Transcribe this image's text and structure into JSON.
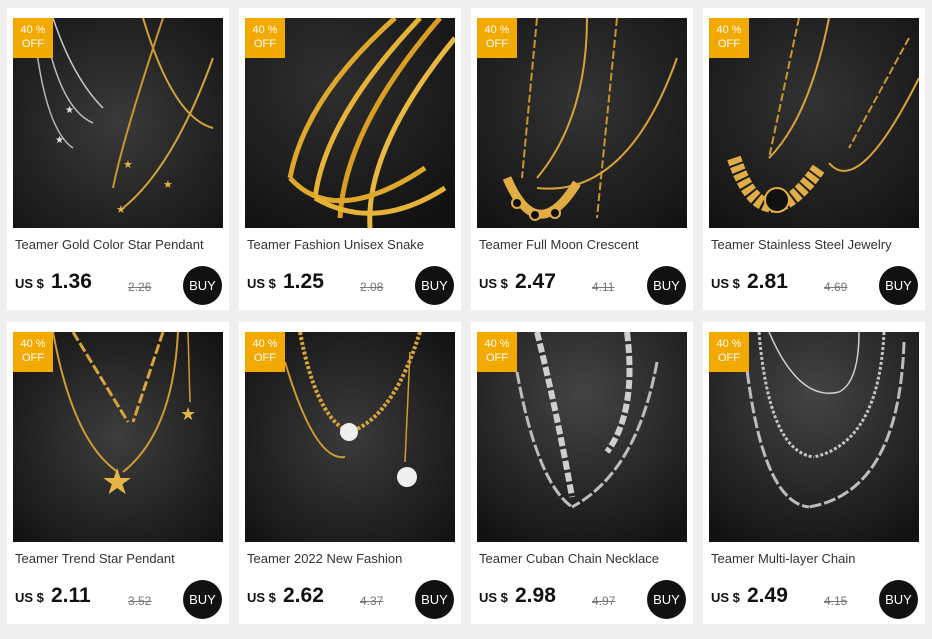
{
  "colors": {
    "badge": "#f2a900",
    "buy_button": "#111111",
    "page_bg": "#efefef"
  },
  "products": [
    {
      "badge_pct": "40 %",
      "badge_off": "OFF",
      "title": "Teamer Gold Color Star Pendant",
      "currency": "US $",
      "price": "1.36",
      "old_price": "2.26",
      "buy_label": "BUY",
      "image": "necklace-gold-silver-stars"
    },
    {
      "badge_pct": "40 %",
      "badge_off": "OFF",
      "title": "Teamer Fashion Unisex Snake",
      "currency": "US $",
      "price": "1.25",
      "old_price": "2.08",
      "buy_label": "BUY",
      "image": "necklace-gold-snake-chains"
    },
    {
      "badge_pct": "40 %",
      "badge_off": "OFF",
      "title": "Teamer Full Moon Crescent",
      "currency": "US $",
      "price": "2.47",
      "old_price": "4.11",
      "buy_label": "BUY",
      "image": "necklace-gold-moon-crescent"
    },
    {
      "badge_pct": "40 %",
      "badge_off": "OFF",
      "title": "Teamer Stainless Steel Jewelry",
      "currency": "US $",
      "price": "2.81",
      "old_price": "4.69",
      "buy_label": "BUY",
      "image": "necklace-gold-lotus-pendant"
    },
    {
      "badge_pct": "40 %",
      "badge_off": "OFF",
      "title": "Teamer Trend Star Pendant",
      "currency": "US $",
      "price": "2.11",
      "old_price": "3.52",
      "buy_label": "BUY",
      "image": "necklace-gold-star-pendant"
    },
    {
      "badge_pct": "40 %",
      "badge_off": "OFF",
      "title": "Teamer 2022 New Fashion",
      "currency": "US $",
      "price": "2.62",
      "old_price": "4.37",
      "buy_label": "BUY",
      "image": "necklace-gold-pearl"
    },
    {
      "badge_pct": "40 %",
      "badge_off": "OFF",
      "title": "Teamer Cuban Chain Necklace",
      "currency": "US $",
      "price": "2.98",
      "old_price": "4.97",
      "buy_label": "BUY",
      "image": "necklace-silver-cuban-chain"
    },
    {
      "badge_pct": "40 %",
      "badge_off": "OFF",
      "title": "Teamer Multi-layer Chain",
      "currency": "US $",
      "price": "2.49",
      "old_price": "4.15",
      "buy_label": "BUY",
      "image": "necklace-silver-multilayer"
    }
  ]
}
